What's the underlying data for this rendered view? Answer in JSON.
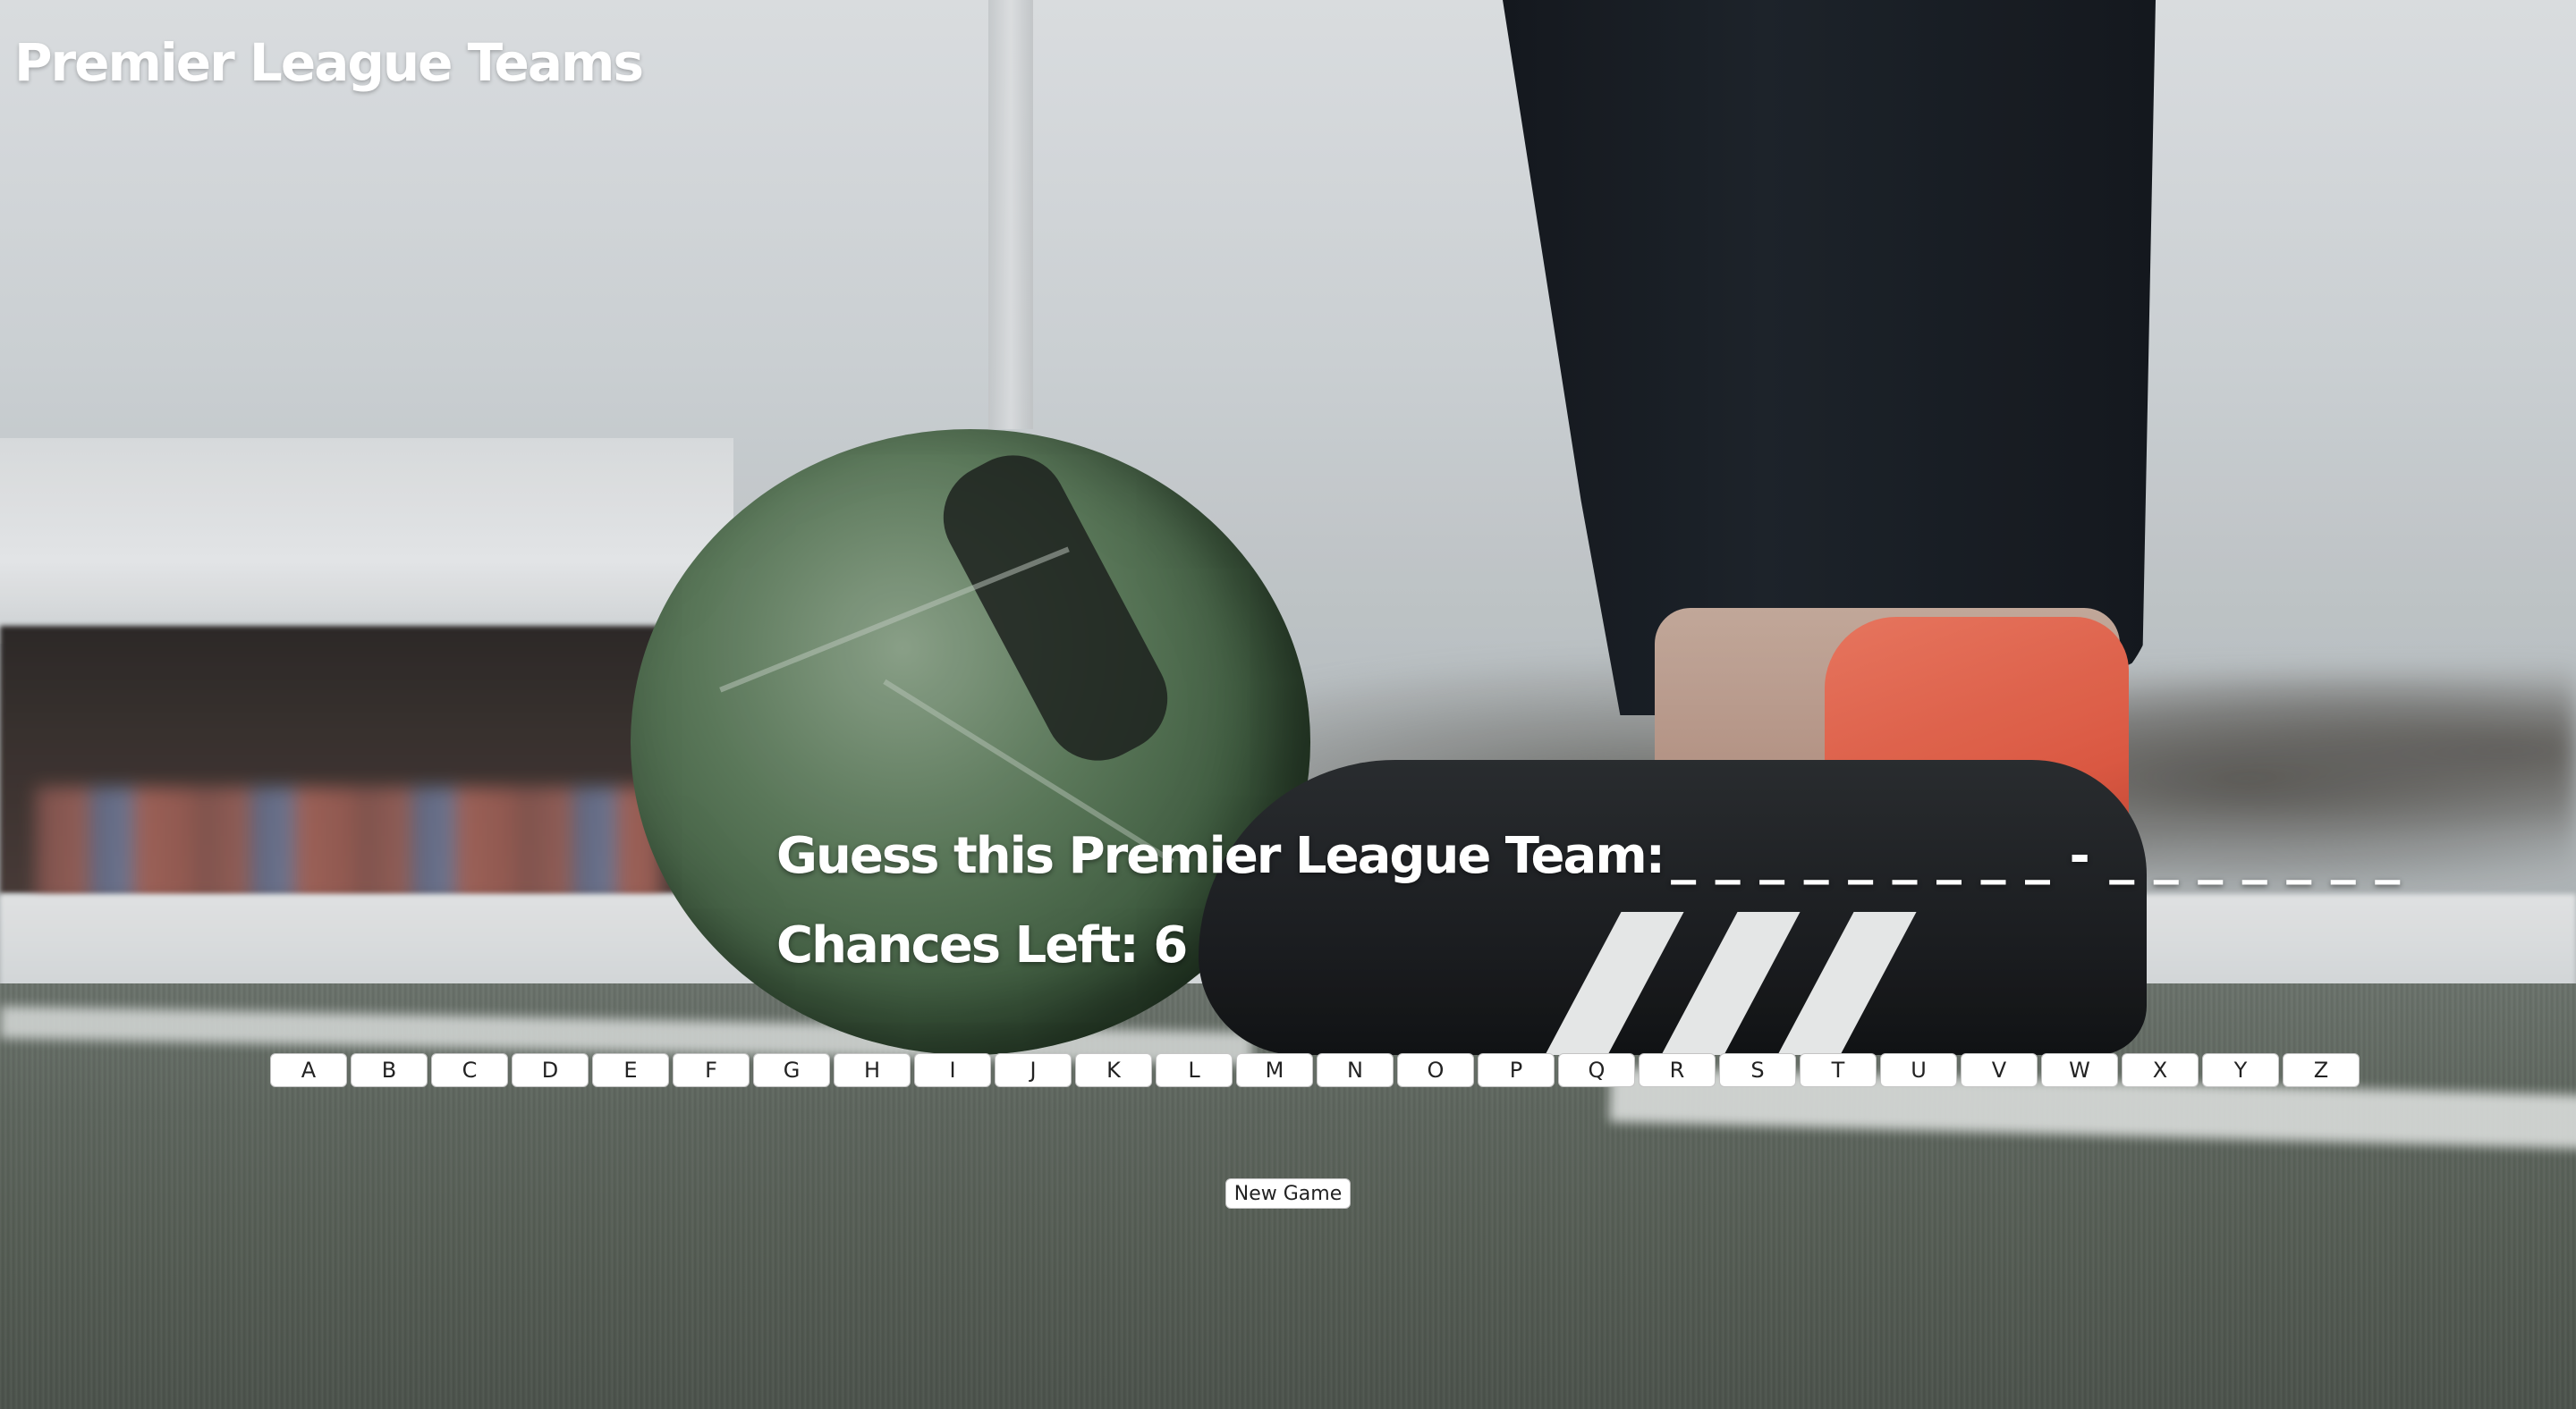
{
  "app": {
    "title": "Premier League Teams"
  },
  "game": {
    "prompt_label": "Guess this Premier League Team:",
    "masked_word": "_ _ _ _ _ _ _ _ _   -   _ _ _ _ _ _ _",
    "chances_label": "Chances Left:",
    "chances_left": "6"
  },
  "keyboard": {
    "letters": [
      "A",
      "B",
      "C",
      "D",
      "E",
      "F",
      "G",
      "H",
      "I",
      "J",
      "K",
      "L",
      "M",
      "N",
      "O",
      "P",
      "Q",
      "R",
      "S",
      "T",
      "U",
      "V",
      "W",
      "X",
      "Y",
      "Z"
    ]
  },
  "controls": {
    "new_game_label": "New Game"
  },
  "colors": {
    "text": "#ffffff",
    "button_bg": "#ffffff",
    "button_border": "#c4c4c4",
    "accent_shoe": "#e35c45"
  }
}
